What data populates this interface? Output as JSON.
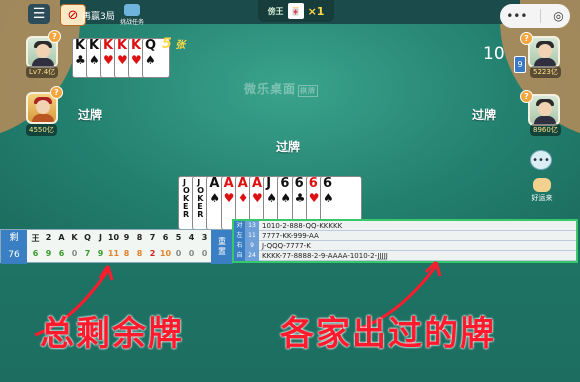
{
  "topbar": {
    "win_text": "再赢3局",
    "task_label": "挑战任务",
    "multiplier_rank": "傍王",
    "multiplier_value": "×1",
    "capsule_more": "•••",
    "capsule_close": "◎"
  },
  "players": {
    "top_left": {
      "score": "Lv7.4亿",
      "badge": "?"
    },
    "left": {
      "score": "4550亿",
      "badge": "?"
    },
    "top_right": {
      "score": "5223亿",
      "badge": "?"
    },
    "right": {
      "score": "8960亿",
      "badge": "?"
    }
  },
  "hand_top_left": {
    "cards": [
      "K",
      "K",
      "K",
      "K",
      "K",
      "Q"
    ],
    "count_prefix": "5",
    "count_suffix": "张"
  },
  "right_player": {
    "card_count": "10",
    "back_label": "9"
  },
  "pass_labels": {
    "left": "过牌",
    "right": "过牌",
    "center": "过牌"
  },
  "logo": {
    "text": "微乐",
    "sub": "桌面",
    "box": "棋牌"
  },
  "my_hand": {
    "cards": [
      {
        "rank": "JOKER",
        "color": "black"
      },
      {
        "rank": "JOKER",
        "color": "black"
      },
      {
        "rank": "A",
        "color": "black"
      },
      {
        "rank": "A",
        "color": "red"
      },
      {
        "rank": "A",
        "color": "red"
      },
      {
        "rank": "A",
        "color": "red"
      },
      {
        "rank": "J",
        "color": "black"
      },
      {
        "rank": "6",
        "color": "black"
      },
      {
        "rank": "6",
        "color": "black"
      },
      {
        "rank": "6",
        "color": "red"
      },
      {
        "rank": "6",
        "color": "black"
      }
    ]
  },
  "counter": {
    "head_top": "剩",
    "head_bottom": "76",
    "ranks": [
      "王",
      "2",
      "A",
      "K",
      "Q",
      "J",
      "10",
      "9",
      "8",
      "7",
      "6",
      "5",
      "4",
      "3"
    ],
    "counts": [
      "6",
      "9",
      "6",
      "0",
      "7",
      "9",
      "11",
      "8",
      "8",
      "2",
      "10",
      "0",
      "0",
      "0"
    ],
    "reset_label_1": "重",
    "reset_label_2": "置"
  },
  "played": {
    "rows": [
      {
        "pos": "对",
        "count": "13",
        "seq": "1010-2-888-QQ-KKKKK"
      },
      {
        "pos": "左",
        "count": "11",
        "seq": "7777-KK-999-AA"
      },
      {
        "pos": "右",
        "count": "9",
        "seq": "J-QQQ-7777-K"
      },
      {
        "pos": "自",
        "count": "24",
        "seq": "KKKK-77-8888-2-9-AAAA-1010-2-JJJJJ"
      }
    ]
  },
  "side_buttons": {
    "chat": "•••",
    "friend_label": "好运来"
  },
  "annotations": {
    "left": "总剩余牌",
    "right": "各家出过的牌"
  },
  "colors": {
    "felt": "#23806f",
    "annotation": "#ff1b2d",
    "panel_accent": "#3a7fc4"
  }
}
